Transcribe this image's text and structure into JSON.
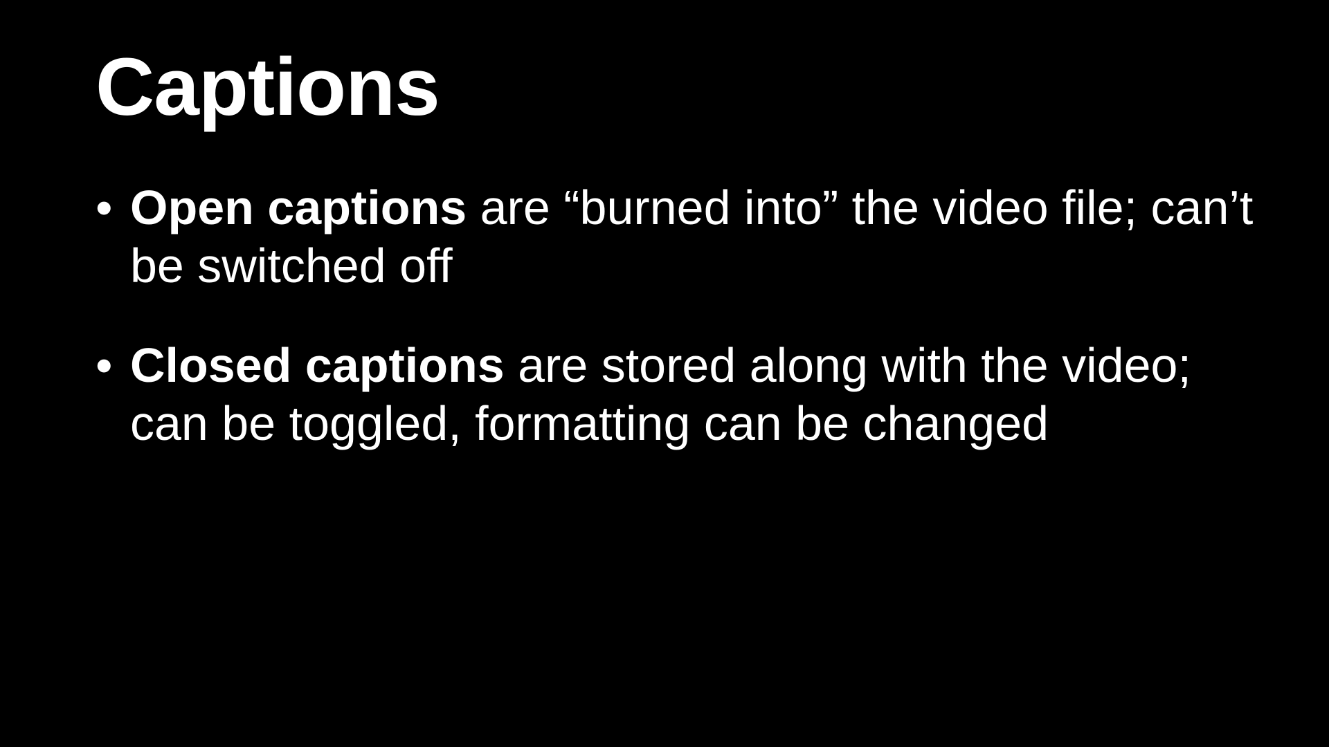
{
  "slide": {
    "title": "Captions",
    "bullet_marker": "•",
    "bullets": [
      {
        "term": "Open captions",
        "text": " are “burned into” the video file; can’t be switched off"
      },
      {
        "term": "Closed captions",
        "text": " are stored along with the video; can be toggled, formatting can be changed"
      }
    ]
  },
  "colors": {
    "background": "#000000",
    "text": "#ffffff"
  }
}
